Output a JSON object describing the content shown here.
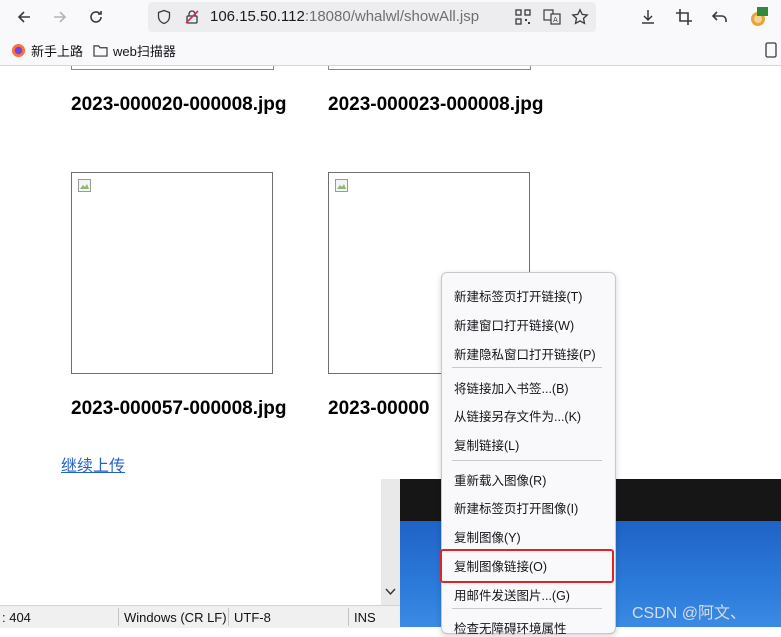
{
  "browser": {
    "url_host": "106.15.50.112",
    "url_rest": ":18080/whalwl/showAll.jsp"
  },
  "bookmarks": [
    {
      "label": "新手上路",
      "icon": "firefox-icon"
    },
    {
      "label": "web扫描器",
      "icon": "folder-icon"
    }
  ],
  "page": {
    "images": [
      {
        "filename": "2023-000020-000008.jpg"
      },
      {
        "filename": "2023-000023-000008.jpg"
      },
      {
        "filename": "2023-000057-000008.jpg"
      },
      {
        "filename": "2023-00000"
      }
    ],
    "continue_link": "继续上传"
  },
  "context_menu": {
    "items": [
      "新建标签页打开链接(T)",
      "新建窗口打开链接(W)",
      "新建隐私窗口打开链接(P)",
      "将链接加入书签...(B)",
      "从链接另存文件为...(K)",
      "复制链接(L)",
      "重新载入图像(R)",
      "新建标签页打开图像(I)",
      "复制图像(Y)",
      "复制图像链接(O)",
      "用邮件发送图片...(G)",
      "检查无障碍环境属性"
    ],
    "highlight_color": "#e02424"
  },
  "editor_status": {
    "position": ": 404",
    "line_ending": "Windows (CR LF)",
    "encoding": "UTF-8",
    "mode": "INS"
  },
  "watermark": "CSDN @阿文、"
}
